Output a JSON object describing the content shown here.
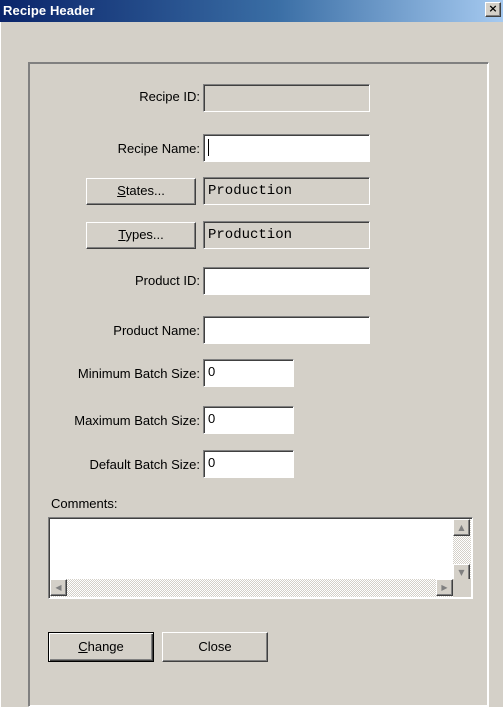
{
  "window": {
    "title": "Recipe Header",
    "close_glyph": "×"
  },
  "form": {
    "recipe_id": {
      "label": "Recipe ID:",
      "value": ""
    },
    "recipe_name": {
      "label": "Recipe Name:",
      "value": ""
    },
    "states": {
      "button_label": "States...",
      "value": "Production"
    },
    "types": {
      "button_label": "Types...",
      "value": "Production"
    },
    "product_id": {
      "label": "Product ID:",
      "value": ""
    },
    "product_name": {
      "label": "Product Name:",
      "value": ""
    },
    "minimum_batch_size": {
      "label": "Minimum Batch Size:",
      "value": "0"
    },
    "maximum_batch_size": {
      "label": "Maximum Batch Size:",
      "value": "0"
    },
    "default_batch_size": {
      "label": "Default Batch Size:",
      "value": "0"
    },
    "comments": {
      "label": "Comments:",
      "value": ""
    }
  },
  "scroll_glyphs": {
    "up": "▲",
    "down": "▼",
    "left": "◀",
    "right": "▶"
  },
  "actions": {
    "change_label": "Change",
    "close_label": "Close"
  }
}
